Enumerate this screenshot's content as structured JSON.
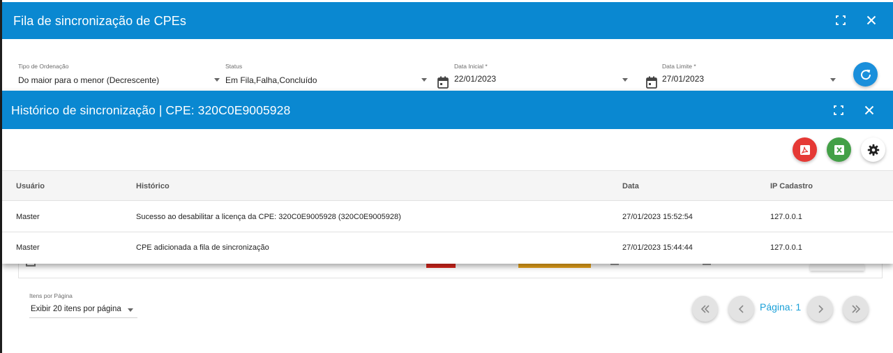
{
  "outer_dialog": {
    "title": "Fila de sincronização de CPEs",
    "maximize_icon": "fullscreen-icon",
    "close_icon": "close-icon"
  },
  "filters": {
    "ordering": {
      "label": "Tipo de Ordenação",
      "value": "Do maior para o menor (Decrescente)"
    },
    "status": {
      "label": "Status",
      "value": "Em Fila,Falha,Concluído"
    },
    "start_date": {
      "label": "Data Inicial *",
      "value": "22/01/2023"
    },
    "end_date": {
      "label": "Data Limite *",
      "value": "27/01/2023"
    },
    "refresh_icon": "refresh-icon"
  },
  "inner_dialog": {
    "title": "Histórico de sincronização | CPE: 320C0E9005928",
    "actions": {
      "pdf_icon": "pdf-icon",
      "excel_icon": "excel-icon",
      "settings_icon": "gear-icon"
    },
    "columns": [
      "Usuário",
      "Histórico",
      "Data",
      "IP Cadastro"
    ],
    "rows": [
      [
        "Master",
        "Sucesso ao desabilitar a licença da CPE: 320C0E9005928 (320C0E9005928)",
        "27/01/2023 15:52:54",
        "127.0.0.1"
      ],
      [
        "Master",
        "CPE adicionada a fila de sincronização",
        "27/01/2023 15:44:44",
        "127.0.0.1"
      ]
    ]
  },
  "pagination": {
    "per_page_label": "Itens por Página",
    "per_page_value": "Exibir 20 itens por página",
    "page_label": "Página: 1"
  },
  "colors": {
    "header": "#0a88d1",
    "pdf": "#e53935",
    "excel": "#43a047",
    "page_text": "#1aa0d8"
  }
}
